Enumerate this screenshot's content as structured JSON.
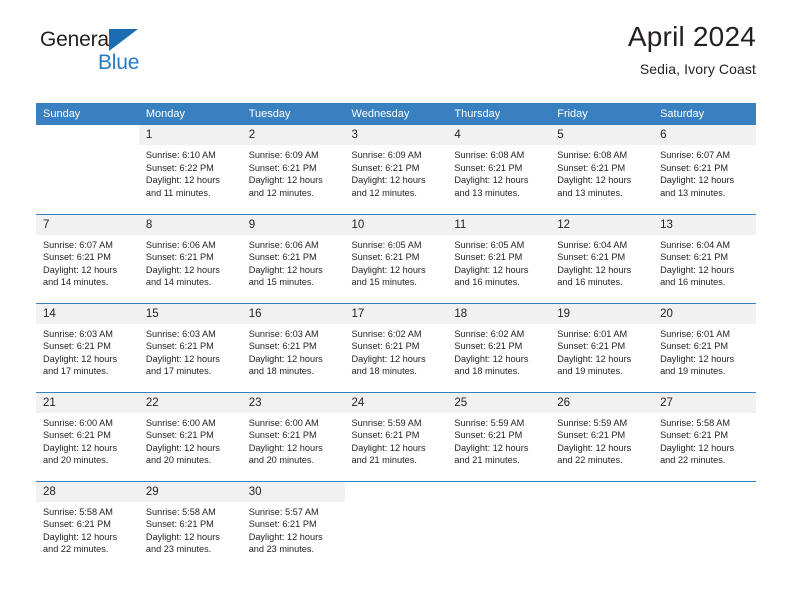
{
  "brand": {
    "name_part1": "General",
    "name_part2": "Blue",
    "triangle_color": "#1b6cb3",
    "blue_color": "#2a7ac0"
  },
  "header": {
    "title": "April 2024",
    "subtitle": "Sedia, Ivory Coast"
  },
  "theme": {
    "header_blue": "#3880c0",
    "date_band_gray": "#f1f1f1",
    "text_color": "#231f20"
  },
  "calendar": {
    "weekday_headers": [
      "Sunday",
      "Monday",
      "Tuesday",
      "Wednesday",
      "Thursday",
      "Friday",
      "Saturday"
    ],
    "labels": {
      "sunrise_prefix": "Sunrise:",
      "sunset_prefix": "Sunset:",
      "daylight_prefix": "Daylight:"
    },
    "weeks": [
      [
        {
          "day": "",
          "line1": "",
          "line2": "",
          "line3": "",
          "line4": ""
        },
        {
          "day": "1",
          "line1": "Sunrise: 6:10 AM",
          "line2": "Sunset: 6:22 PM",
          "line3": "Daylight: 12 hours",
          "line4": "and 11 minutes."
        },
        {
          "day": "2",
          "line1": "Sunrise: 6:09 AM",
          "line2": "Sunset: 6:21 PM",
          "line3": "Daylight: 12 hours",
          "line4": "and 12 minutes."
        },
        {
          "day": "3",
          "line1": "Sunrise: 6:09 AM",
          "line2": "Sunset: 6:21 PM",
          "line3": "Daylight: 12 hours",
          "line4": "and 12 minutes."
        },
        {
          "day": "4",
          "line1": "Sunrise: 6:08 AM",
          "line2": "Sunset: 6:21 PM",
          "line3": "Daylight: 12 hours",
          "line4": "and 13 minutes."
        },
        {
          "day": "5",
          "line1": "Sunrise: 6:08 AM",
          "line2": "Sunset: 6:21 PM",
          "line3": "Daylight: 12 hours",
          "line4": "and 13 minutes."
        },
        {
          "day": "6",
          "line1": "Sunrise: 6:07 AM",
          "line2": "Sunset: 6:21 PM",
          "line3": "Daylight: 12 hours",
          "line4": "and 13 minutes."
        }
      ],
      [
        {
          "day": "7",
          "line1": "Sunrise: 6:07 AM",
          "line2": "Sunset: 6:21 PM",
          "line3": "Daylight: 12 hours",
          "line4": "and 14 minutes."
        },
        {
          "day": "8",
          "line1": "Sunrise: 6:06 AM",
          "line2": "Sunset: 6:21 PM",
          "line3": "Daylight: 12 hours",
          "line4": "and 14 minutes."
        },
        {
          "day": "9",
          "line1": "Sunrise: 6:06 AM",
          "line2": "Sunset: 6:21 PM",
          "line3": "Daylight: 12 hours",
          "line4": "and 15 minutes."
        },
        {
          "day": "10",
          "line1": "Sunrise: 6:05 AM",
          "line2": "Sunset: 6:21 PM",
          "line3": "Daylight: 12 hours",
          "line4": "and 15 minutes."
        },
        {
          "day": "11",
          "line1": "Sunrise: 6:05 AM",
          "line2": "Sunset: 6:21 PM",
          "line3": "Daylight: 12 hours",
          "line4": "and 16 minutes."
        },
        {
          "day": "12",
          "line1": "Sunrise: 6:04 AM",
          "line2": "Sunset: 6:21 PM",
          "line3": "Daylight: 12 hours",
          "line4": "and 16 minutes."
        },
        {
          "day": "13",
          "line1": "Sunrise: 6:04 AM",
          "line2": "Sunset: 6:21 PM",
          "line3": "Daylight: 12 hours",
          "line4": "and 16 minutes."
        }
      ],
      [
        {
          "day": "14",
          "line1": "Sunrise: 6:03 AM",
          "line2": "Sunset: 6:21 PM",
          "line3": "Daylight: 12 hours",
          "line4": "and 17 minutes."
        },
        {
          "day": "15",
          "line1": "Sunrise: 6:03 AM",
          "line2": "Sunset: 6:21 PM",
          "line3": "Daylight: 12 hours",
          "line4": "and 17 minutes."
        },
        {
          "day": "16",
          "line1": "Sunrise: 6:03 AM",
          "line2": "Sunset: 6:21 PM",
          "line3": "Daylight: 12 hours",
          "line4": "and 18 minutes."
        },
        {
          "day": "17",
          "line1": "Sunrise: 6:02 AM",
          "line2": "Sunset: 6:21 PM",
          "line3": "Daylight: 12 hours",
          "line4": "and 18 minutes."
        },
        {
          "day": "18",
          "line1": "Sunrise: 6:02 AM",
          "line2": "Sunset: 6:21 PM",
          "line3": "Daylight: 12 hours",
          "line4": "and 18 minutes."
        },
        {
          "day": "19",
          "line1": "Sunrise: 6:01 AM",
          "line2": "Sunset: 6:21 PM",
          "line3": "Daylight: 12 hours",
          "line4": "and 19 minutes."
        },
        {
          "day": "20",
          "line1": "Sunrise: 6:01 AM",
          "line2": "Sunset: 6:21 PM",
          "line3": "Daylight: 12 hours",
          "line4": "and 19 minutes."
        }
      ],
      [
        {
          "day": "21",
          "line1": "Sunrise: 6:00 AM",
          "line2": "Sunset: 6:21 PM",
          "line3": "Daylight: 12 hours",
          "line4": "and 20 minutes."
        },
        {
          "day": "22",
          "line1": "Sunrise: 6:00 AM",
          "line2": "Sunset: 6:21 PM",
          "line3": "Daylight: 12 hours",
          "line4": "and 20 minutes."
        },
        {
          "day": "23",
          "line1": "Sunrise: 6:00 AM",
          "line2": "Sunset: 6:21 PM",
          "line3": "Daylight: 12 hours",
          "line4": "and 20 minutes."
        },
        {
          "day": "24",
          "line1": "Sunrise: 5:59 AM",
          "line2": "Sunset: 6:21 PM",
          "line3": "Daylight: 12 hours",
          "line4": "and 21 minutes."
        },
        {
          "day": "25",
          "line1": "Sunrise: 5:59 AM",
          "line2": "Sunset: 6:21 PM",
          "line3": "Daylight: 12 hours",
          "line4": "and 21 minutes."
        },
        {
          "day": "26",
          "line1": "Sunrise: 5:59 AM",
          "line2": "Sunset: 6:21 PM",
          "line3": "Daylight: 12 hours",
          "line4": "and 22 minutes."
        },
        {
          "day": "27",
          "line1": "Sunrise: 5:58 AM",
          "line2": "Sunset: 6:21 PM",
          "line3": "Daylight: 12 hours",
          "line4": "and 22 minutes."
        }
      ],
      [
        {
          "day": "28",
          "line1": "Sunrise: 5:58 AM",
          "line2": "Sunset: 6:21 PM",
          "line3": "Daylight: 12 hours",
          "line4": "and 22 minutes."
        },
        {
          "day": "29",
          "line1": "Sunrise: 5:58 AM",
          "line2": "Sunset: 6:21 PM",
          "line3": "Daylight: 12 hours",
          "line4": "and 23 minutes."
        },
        {
          "day": "30",
          "line1": "Sunrise: 5:57 AM",
          "line2": "Sunset: 6:21 PM",
          "line3": "Daylight: 12 hours",
          "line4": "and 23 minutes."
        },
        {
          "day": "",
          "line1": "",
          "line2": "",
          "line3": "",
          "line4": ""
        },
        {
          "day": "",
          "line1": "",
          "line2": "",
          "line3": "",
          "line4": ""
        },
        {
          "day": "",
          "line1": "",
          "line2": "",
          "line3": "",
          "line4": ""
        },
        {
          "day": "",
          "line1": "",
          "line2": "",
          "line3": "",
          "line4": ""
        }
      ]
    ]
  }
}
